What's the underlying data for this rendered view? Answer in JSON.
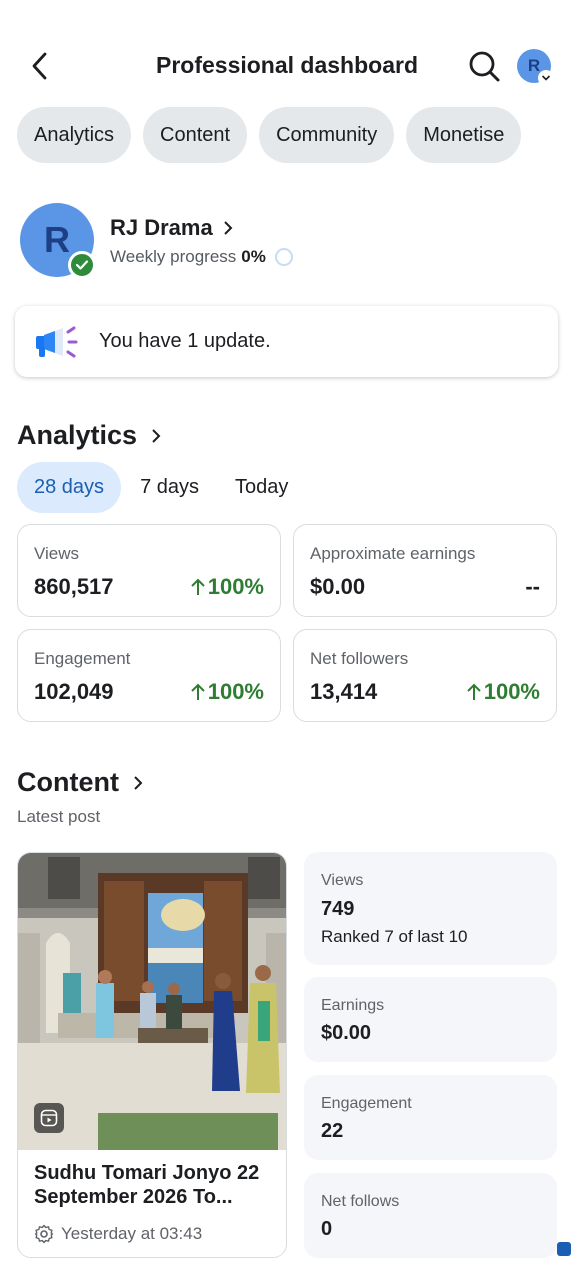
{
  "header": {
    "title": "Professional dashboard",
    "avatar_letter": "R"
  },
  "tabs": [
    "Analytics",
    "Content",
    "Community",
    "Monetise"
  ],
  "profile": {
    "avatar_letter": "R",
    "name": "RJ Drama",
    "progress_label": "Weekly progress",
    "progress_value": "0%"
  },
  "update_banner": {
    "text": "You have 1 update."
  },
  "analytics": {
    "title": "Analytics",
    "ranges": [
      "28 days",
      "7 days",
      "Today"
    ],
    "selected_range": "28 days",
    "metrics": [
      {
        "label": "Views",
        "value": "860,517",
        "change": "100%",
        "trend": "up"
      },
      {
        "label": "Approximate earnings",
        "value": "$0.00",
        "change": "--",
        "trend": "none"
      },
      {
        "label": "Engagement",
        "value": "102,049",
        "change": "100%",
        "trend": "up"
      },
      {
        "label": "Net followers",
        "value": "13,414",
        "change": "100%",
        "trend": "up"
      }
    ]
  },
  "content": {
    "title": "Content",
    "subtitle": "Latest post",
    "post": {
      "title": "Sudhu Tomari Jonyo 22 September 2026 To...",
      "time": "Yesterday at 03:43"
    },
    "stats": [
      {
        "label": "Views",
        "value": "749",
        "sub": "Ranked 7 of last 10"
      },
      {
        "label": "Earnings",
        "value": "$0.00"
      },
      {
        "label": "Engagement",
        "value": "22"
      },
      {
        "label": "Net follows",
        "value": "0"
      }
    ]
  },
  "colors": {
    "accent": "#1a5fb4",
    "positive": "#2e7d32",
    "chip_bg": "#e4e8ea",
    "avatar_bg": "#5b96e6"
  }
}
